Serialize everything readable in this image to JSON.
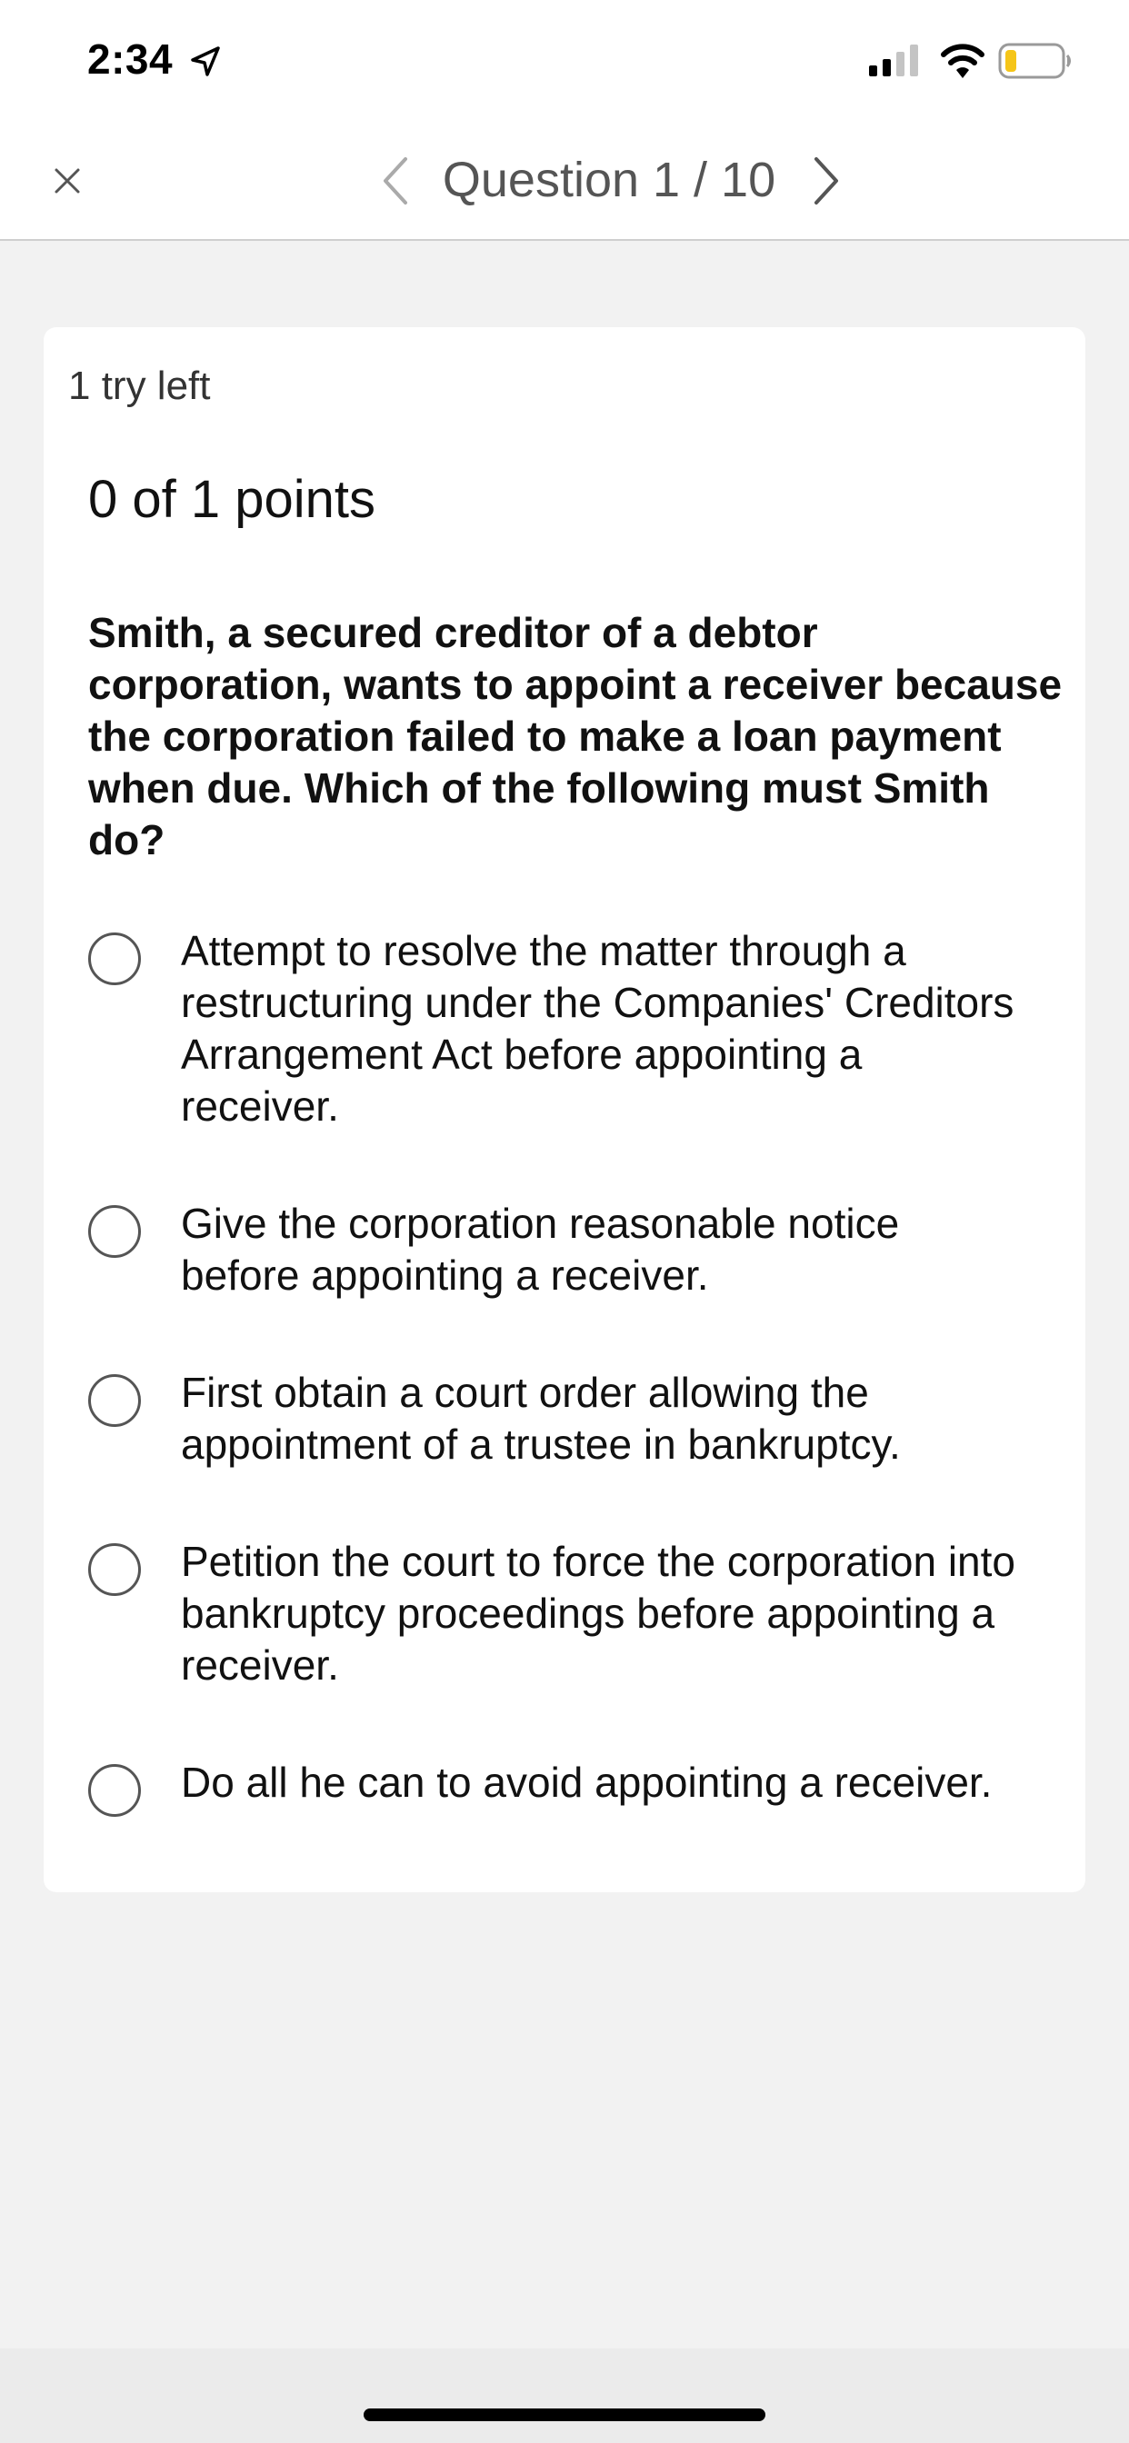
{
  "status_bar": {
    "time": "2:34",
    "location_icon": "location-arrow-icon",
    "signal_icon": "cellular-signal-icon",
    "wifi_icon": "wifi-icon",
    "battery_icon": "battery-low-icon",
    "battery_color": "#f5c518"
  },
  "nav": {
    "close_icon": "close-icon",
    "prev_icon": "chevron-left-icon",
    "next_icon": "chevron-right-icon",
    "title": "Question 1 / 10"
  },
  "question": {
    "tries_left": "1 try left",
    "points": "0 of 1 points",
    "text": "Smith, a secured creditor of a debtor corporation, wants to appoint a receiver because the corporation failed to make a loan payment when due. Which of the following must Smith do?",
    "options": [
      {
        "label": "Attempt to resolve the matter through a restructuring under the Companies' Creditors Arrangement Act before appointing a receiver."
      },
      {
        "label": "Give the corporation reasonable notice before appointing a receiver."
      },
      {
        "label": "First obtain a court order allowing the appointment of a trustee in bankruptcy."
      },
      {
        "label": "Petition the court to force the corporation into bankruptcy proceedings before appointing a receiver."
      },
      {
        "label": "Do all he can to avoid appointing a receiver."
      }
    ]
  },
  "colors": {
    "background": "#f2f2f2",
    "card": "#ffffff",
    "nav_title": "#555555"
  }
}
